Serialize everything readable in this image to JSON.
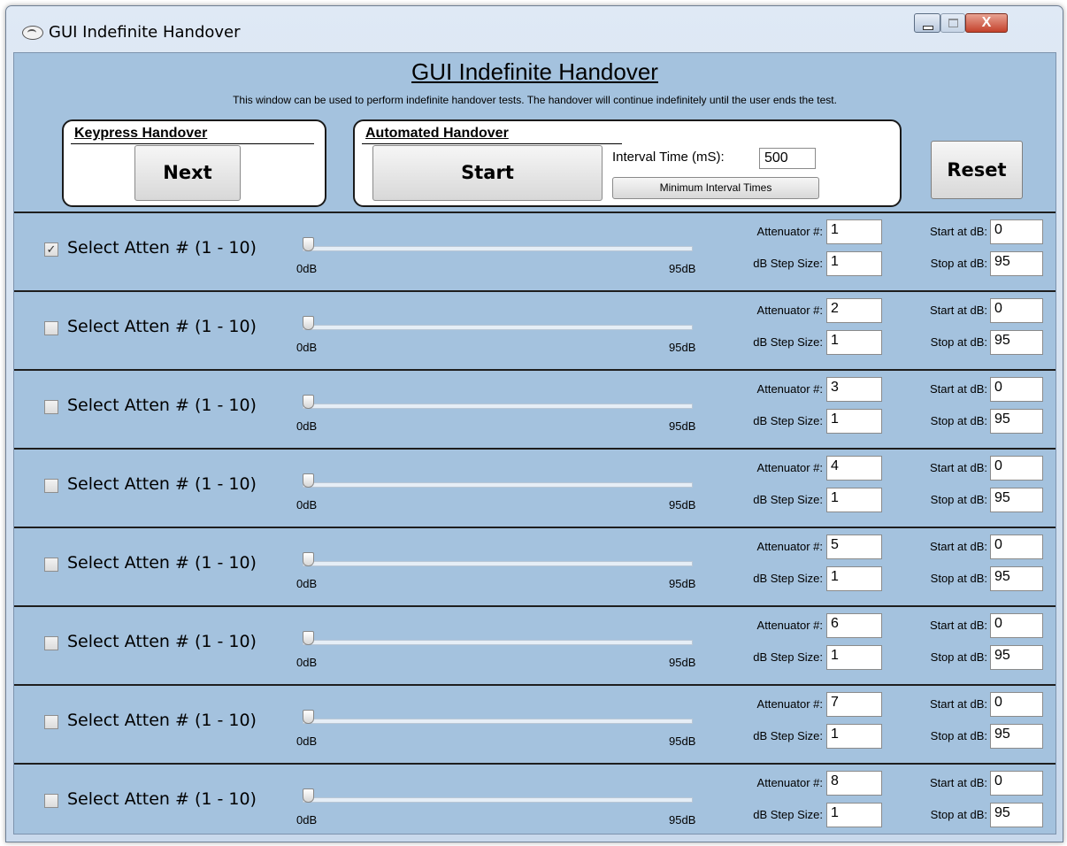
{
  "window": {
    "title": "GUI Indefinite Handover",
    "close_label": "X"
  },
  "header": {
    "title": "GUI Indefinite Handover",
    "description": "This window can be used to perform indefinite handover tests.  The handover will continue indefinitely until the user ends the test."
  },
  "keypress": {
    "title": "Keypress Handover",
    "next_label": "Next"
  },
  "automated": {
    "title": "Automated Handover",
    "start_label": "Start",
    "interval_label": "Interval Time (mS):",
    "interval_value": "500",
    "min_interval_label": "Minimum Interval Times"
  },
  "reset_label": "Reset",
  "rows": [
    {
      "checked": true,
      "label": "Select Atten # (1 - 10)",
      "min": "0dB",
      "max": "95dB",
      "att_label": "Attenuator #:",
      "att": "1",
      "step_label": "dB Step Size:",
      "step": "1",
      "start_label": "Start at dB:",
      "start": "0",
      "stop_label": "Stop at dB:",
      "stop": "95"
    },
    {
      "checked": false,
      "label": "Select Atten # (1 - 10)",
      "min": "0dB",
      "max": "95dB",
      "att_label": "Attenuator #:",
      "att": "2",
      "step_label": "dB Step Size:",
      "step": "1",
      "start_label": "Start at dB:",
      "start": "0",
      "stop_label": "Stop at dB:",
      "stop": "95"
    },
    {
      "checked": false,
      "label": "Select Atten # (1 - 10)",
      "min": "0dB",
      "max": "95dB",
      "att_label": "Attenuator #:",
      "att": "3",
      "step_label": "dB Step Size:",
      "step": "1",
      "start_label": "Start at dB:",
      "start": "0",
      "stop_label": "Stop at dB:",
      "stop": "95"
    },
    {
      "checked": false,
      "label": "Select Atten # (1 - 10)",
      "min": "0dB",
      "max": "95dB",
      "att_label": "Attenuator #:",
      "att": "4",
      "step_label": "dB Step Size:",
      "step": "1",
      "start_label": "Start at dB:",
      "start": "0",
      "stop_label": "Stop at dB:",
      "stop": "95"
    },
    {
      "checked": false,
      "label": "Select Atten # (1 - 10)",
      "min": "0dB",
      "max": "95dB",
      "att_label": "Attenuator #:",
      "att": "5",
      "step_label": "dB Step Size:",
      "step": "1",
      "start_label": "Start at dB:",
      "start": "0",
      "stop_label": "Stop at dB:",
      "stop": "95"
    },
    {
      "checked": false,
      "label": "Select Atten # (1 - 10)",
      "min": "0dB",
      "max": "95dB",
      "att_label": "Attenuator #:",
      "att": "6",
      "step_label": "dB Step Size:",
      "step": "1",
      "start_label": "Start at dB:",
      "start": "0",
      "stop_label": "Stop at dB:",
      "stop": "95"
    },
    {
      "checked": false,
      "label": "Select Atten # (1 - 10)",
      "min": "0dB",
      "max": "95dB",
      "att_label": "Attenuator #:",
      "att": "7",
      "step_label": "dB Step Size:",
      "step": "1",
      "start_label": "Start at dB:",
      "start": "0",
      "stop_label": "Stop at dB:",
      "stop": "95"
    },
    {
      "checked": false,
      "label": "Select Atten # (1 - 10)",
      "min": "0dB",
      "max": "95dB",
      "att_label": "Attenuator #:",
      "att": "8",
      "step_label": "dB Step Size:",
      "step": "1",
      "start_label": "Start at dB:",
      "start": "0",
      "stop_label": "Stop at dB:",
      "stop": "95"
    }
  ]
}
